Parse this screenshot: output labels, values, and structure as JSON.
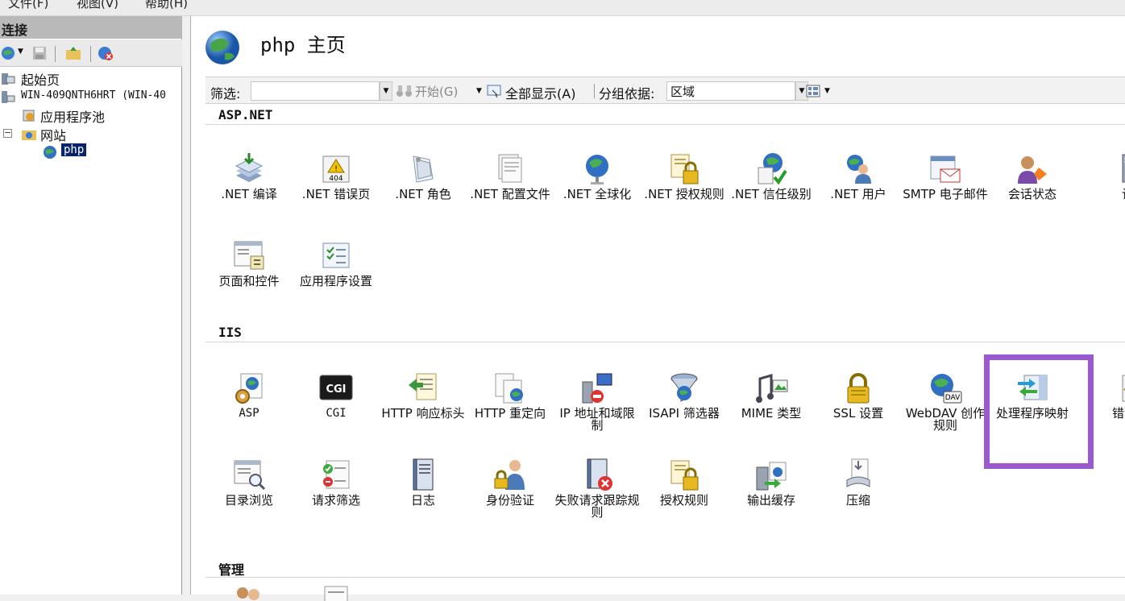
{
  "menu": [
    "文件(F)",
    "视图(V)",
    "帮助(H)"
  ],
  "connections": {
    "title": "连接",
    "tree": {
      "start": "起始页",
      "server": "WIN-409QNTH6HRT (WIN-40",
      "apppool": "应用程序池",
      "sites": "网站",
      "site": "php"
    }
  },
  "header": {
    "title": "php 主页"
  },
  "filter": {
    "label": "筛选:",
    "go": "开始(G)",
    "showall": "全部显示(A)",
    "groupby_label": "分组依据:",
    "groupby_value": "区域"
  },
  "sections": {
    "aspnet": {
      "title": "ASP.NET",
      "items": [
        ".NET 编译",
        ".NET 错误页",
        ".NET 角色",
        ".NET 配置文件",
        ".NET 全球化",
        ".NET 授权规则",
        ".NET 信任级别",
        ".NET 用户",
        "SMTP 电子邮件",
        "会话状态",
        "计算机",
        "页面和控件",
        "应用程序设置"
      ]
    },
    "iis": {
      "title": "IIS",
      "items": [
        "ASP",
        "CGI",
        "HTTP 响应标头",
        "HTTP 重定向",
        "IP 地址和域限制",
        "ISAPI 筛选器",
        "MIME 类型",
        "SSL 设置",
        "WebDAV 创作规则",
        "处理程序映射",
        "错误页",
        "目录浏览",
        "请求筛选",
        "日志",
        "身份验证",
        "失败请求跟踪规则",
        "授权规则",
        "输出缓存",
        "压缩"
      ]
    },
    "manage": {
      "title": "管理"
    }
  },
  "icons": {
    "cgi_badge": "CGI",
    "error_badge": "404",
    "webdav_badge": "DAV"
  },
  "colors": {
    "highlight": "#9b59d0",
    "selection": "#0a246a"
  }
}
